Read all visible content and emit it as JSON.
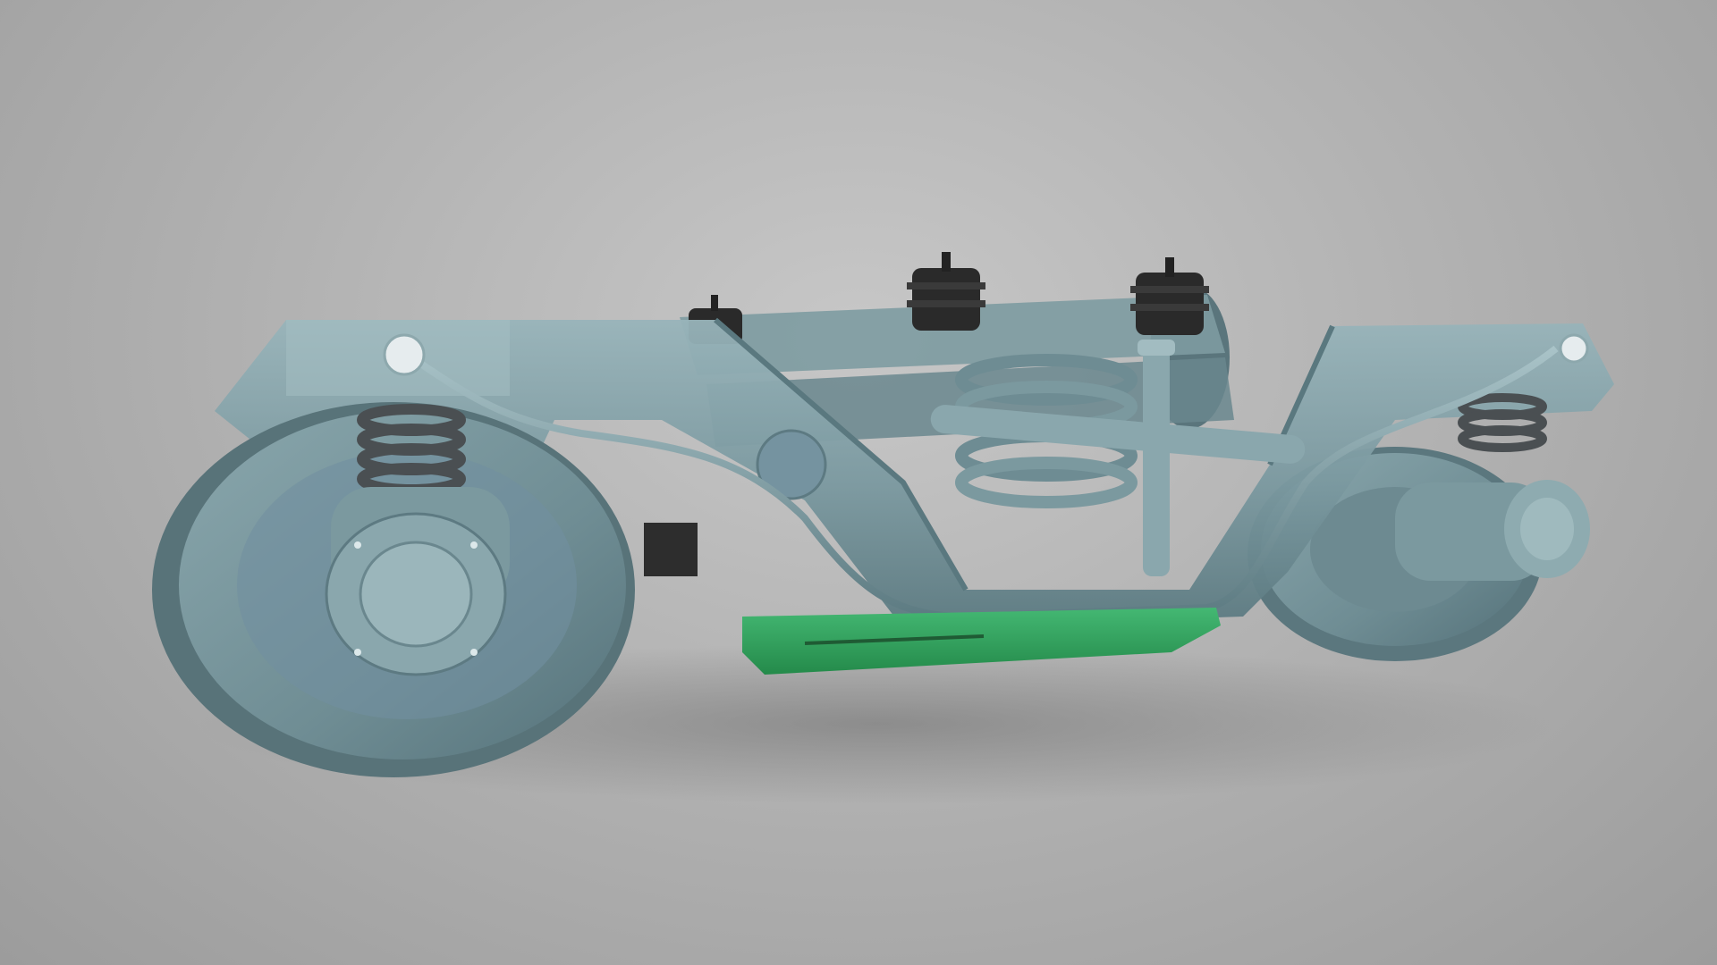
{
  "scene": {
    "subject": "train-bogie-3d-render",
    "background_color": "#b3b3b3",
    "frame_color": "#6e8e95",
    "frame_highlight": "#94b2b8",
    "frame_shadow": "#4f6e75",
    "spring_color": "#4a4f52",
    "brake_shoe_color": "#2ea05a",
    "bellows_color": "#2a2a2a"
  }
}
